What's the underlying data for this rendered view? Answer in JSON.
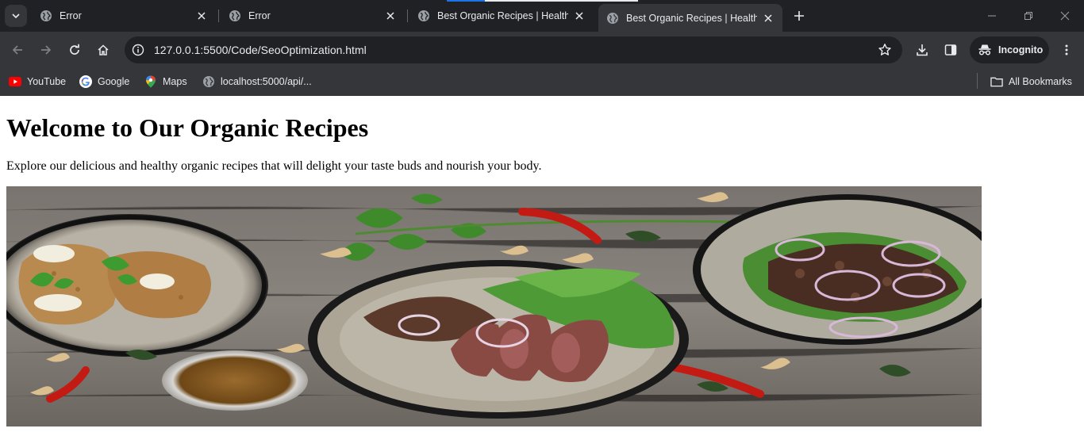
{
  "browser": {
    "tabs": [
      {
        "title": "Error",
        "active": false
      },
      {
        "title": "Error",
        "active": false
      },
      {
        "title": "Best Organic Recipes | Healthy",
        "active": false
      },
      {
        "title": "Best Organic Recipes | Healthy",
        "active": true
      }
    ],
    "address": "127.0.0.1:5500/Code/SeoOptimization.html",
    "profile_label": "Incognito",
    "bookmarks": [
      {
        "label": "YouTube",
        "icon": "youtube-icon"
      },
      {
        "label": "Google",
        "icon": "google-icon"
      },
      {
        "label": "Maps",
        "icon": "maps-icon"
      },
      {
        "label": "localhost:5000/api/...",
        "icon": "globe-icon"
      }
    ],
    "all_bookmarks_label": "All Bookmarks"
  },
  "page": {
    "heading": "Welcome to Our Organic Recipes",
    "intro": "Explore our delicious and healthy organic recipes that will delight your taste buds and nourish your body."
  },
  "colors": {
    "tabstrip_bg": "#202124",
    "toolbar_bg": "#35363a",
    "text_light": "#e8eaed",
    "icon_gray": "#9aa0a6",
    "loading_blue": "#1a73e8"
  }
}
